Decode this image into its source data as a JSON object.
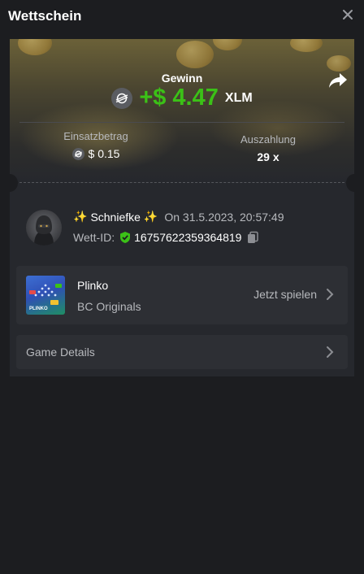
{
  "header": {
    "title": "Wettschein",
    "close_icon": "close-icon"
  },
  "win": {
    "label": "Gewinn",
    "amount": "+$ 4.47",
    "currency": "XLM",
    "color": "#3bc117"
  },
  "stats": {
    "bet_label": "Einsatzbetrag",
    "bet_value": "$ 0.15",
    "payout_label": "Auszahlung",
    "payout_value": "29 x"
  },
  "user": {
    "sparkle_left": "✨",
    "name": "Schniefke",
    "sparkle_right": "✨",
    "date": "On 31.5.2023, 20:57:49",
    "bet_id_label": "Wett-ID:",
    "bet_id": "16757622359364819"
  },
  "game": {
    "thumb_text": "PLINKO",
    "name": "Plinko",
    "provider": "BC Originals",
    "play_label": "Jetzt spielen"
  },
  "details": {
    "label": "Game Details"
  },
  "colors": {
    "background": "#1c1d20",
    "card": "#26282d",
    "row": "#2d2f34",
    "muted_text": "#b7b9bd",
    "verified": "#3bc117"
  }
}
